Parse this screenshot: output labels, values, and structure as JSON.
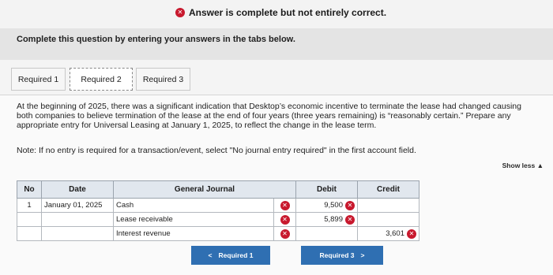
{
  "banner": {
    "status_icon": "x-circle-icon",
    "message": "Answer is complete but not entirely correct."
  },
  "instructions": "Complete this question by entering your answers in the tabs below.",
  "tabs": [
    {
      "label": "Required 1"
    },
    {
      "label": "Required 2",
      "active": true
    },
    {
      "label": "Required 3"
    }
  ],
  "question": {
    "text": "At the beginning of 2025, there was a significant indication that Desktop’s economic incentive to terminate the lease had changed causing both companies to believe termination of the lease at the end of four years (three years remaining) is “reasonably certain.” Prepare any appropriate entry for Universal Leasing at January 1, 2025, to reflect the change in the lease term.",
    "note": "Note: If no entry is required for a transaction/event, select \"No journal entry required\" in the first account field.",
    "toggle_label": "Show less ▲"
  },
  "journal": {
    "headers": {
      "no": "No",
      "date": "Date",
      "account": "General Journal",
      "debit": "Debit",
      "credit": "Credit"
    },
    "rows": [
      {
        "no": "1",
        "date": "January 01, 2025",
        "account": "Cash",
        "debit": "9,500",
        "credit": ""
      },
      {
        "no": "",
        "date": "",
        "account": "Lease receivable",
        "debit": "5,899",
        "credit": ""
      },
      {
        "no": "",
        "date": "",
        "account": "Interest revenue",
        "debit": "",
        "credit": "3,601"
      }
    ]
  },
  "nav": {
    "prev_label": "Required 1",
    "next_label": "Required 3",
    "prev_icon": "chevron-left-icon",
    "next_icon": "chevron-right-icon"
  },
  "colors": {
    "error": "#c8192e",
    "button": "#2f6fb2",
    "table_header": "#e1e7ee"
  }
}
